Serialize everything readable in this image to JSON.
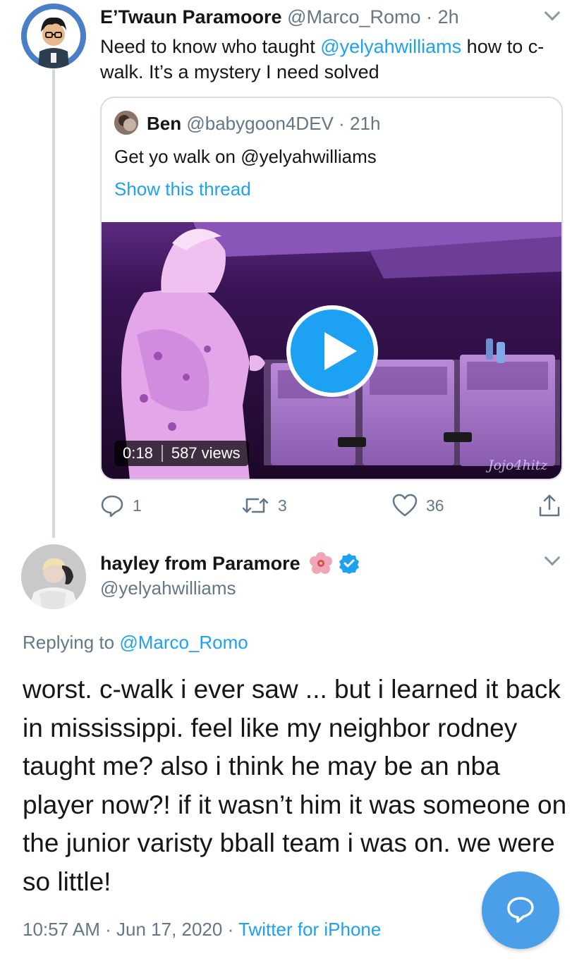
{
  "tweet1": {
    "name": "E’Twaun Paramoore",
    "handle": "@Marco_Romo",
    "separator": "·",
    "time": "2h",
    "text_parts": [
      "Need to know who taught ",
      "@yelyahwilliams",
      " how to c-walk. It’s a mystery I need solved"
    ],
    "quote": {
      "name": "Ben",
      "handle": "@babygoon4DEV",
      "separator": "·",
      "time": "21h",
      "text": "Get yo walk on @yelyahwilliams",
      "show_thread": "Show this thread",
      "video": {
        "duration": "0:18",
        "views": "587 views",
        "watermark": "Jojo4hitz",
        "icon": "play-icon"
      }
    },
    "actions": {
      "reply_count": "1",
      "retweet_count": "3",
      "like_count": "36"
    }
  },
  "tweet2": {
    "name": "hayley from Paramore",
    "handle": "@yelyahwilliams",
    "replying_prefix": "Replying to ",
    "replying_to": "@Marco_Romo",
    "text": "worst. c-walk i ever saw ... but i learned it back in mississippi. feel like my neighbor rodney taught me? also i think he may be an nba player now?! if it wasn’t him it was someone on the junior varisty bball team i was on. we were so little!",
    "time": "10:57 AM",
    "date": "Jun 17, 2020",
    "source": "Twitter for iPhone",
    "separator": "·"
  },
  "colors": {
    "link": "#1da1f2",
    "muted": "#657786",
    "fab": "#4a9fe8"
  }
}
